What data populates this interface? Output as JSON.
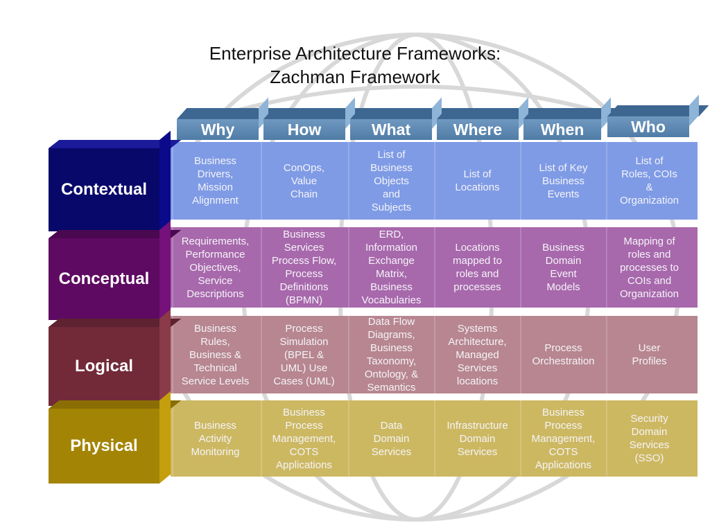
{
  "title": {
    "line1": "Enterprise Architecture Frameworks:",
    "line2": "Zachman Framework"
  },
  "background_icon": "globe-wireframe-icon",
  "columns": [
    {
      "label": "Why"
    },
    {
      "label": "How"
    },
    {
      "label": "What"
    },
    {
      "label": "Where"
    },
    {
      "label": "When"
    },
    {
      "label": "Who"
    }
  ],
  "rows": [
    {
      "label": "Contextual",
      "colors": {
        "front": "#08086b",
        "side": "#0a0a8a",
        "top": "#1a1a9a",
        "band": "#7f9be6"
      },
      "cells": [
        "Business\nDrivers,\nMission\nAlignment",
        "ConOps,\nValue\nChain",
        "List of\nBusiness\nObjects\nand\nSubjects",
        "List of\nLocations",
        "List of Key\nBusiness\nEvents",
        "List of\nRoles, COIs\n&\nOrganization"
      ]
    },
    {
      "label": "Conceptual",
      "colors": {
        "front": "#5e0a62",
        "side": "#76107a",
        "top": "#4a0850",
        "band": "#a868ac"
      },
      "cells": [
        "Requirements,\nPerformance\nObjectives,\nService\nDescriptions",
        "Business\nServices\nProcess Flow,\nProcess\nDefinitions\n(BPMN)",
        "ERD,\nInformation\nExchange\nMatrix,\nBusiness\nVocabularies",
        "Locations\nmapped to\nroles and\nprocesses",
        "Business\nDomain\nEvent\nModels",
        "Mapping of\nroles and\nprocesses to\nCOIs and\nOrganization"
      ]
    },
    {
      "label": "Logical",
      "colors": {
        "front": "#722a38",
        "side": "#8a3a48",
        "top": "#5e2230",
        "band": "#b78690"
      },
      "cells": [
        "Business\nRules,\nBusiness &\nTechnical\nService Levels",
        "Process\nSimulation\n(BPEL &\nUML) Use\nCases (UML)",
        "Data Flow\nDiagrams,\nBusiness\nTaxonomy,\nOntology, &\nSemantics",
        "Systems\nArchitecture,\nManaged\nServices\nlocations",
        "Process\nOrchestration",
        "User\nProfiles"
      ]
    },
    {
      "label": "Physical",
      "colors": {
        "front": "#a48404",
        "side": "#c49e0c",
        "top": "#8a6e04",
        "band": "#cdb862"
      },
      "cells": [
        "Business\nActivity\nMonitoring",
        "Business\nProcess\nManagement,\nCOTS\nApplications",
        "Data\nDomain\nServices",
        "Infrastructure\nDomain\nServices",
        "Business\nProcess\nManagement,\nCOTS\nApplications",
        "Security\nDomain\nServices\n(SSO)"
      ]
    }
  ]
}
